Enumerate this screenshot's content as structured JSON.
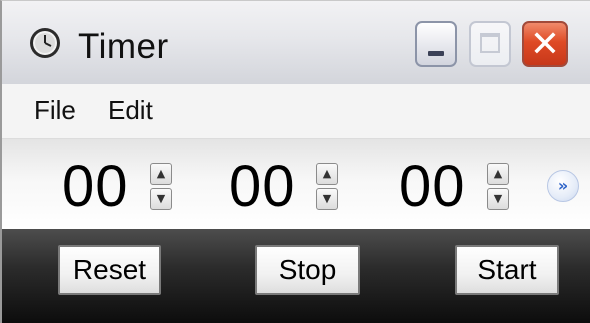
{
  "window": {
    "title": "Timer",
    "controls": {
      "minimize_icon": "minimize-icon",
      "maximize_icon": "maximize-icon",
      "close_glyph": "✕"
    }
  },
  "menu": {
    "items": [
      {
        "label": "File"
      },
      {
        "label": "Edit"
      }
    ]
  },
  "timer": {
    "hours": "00",
    "minutes": "00",
    "seconds": "00",
    "spin_up_glyph": "▲",
    "spin_down_glyph": "▼",
    "expand_glyph": "»"
  },
  "buttons": {
    "reset": "Reset",
    "stop": "Stop",
    "start": "Start"
  },
  "colors": {
    "accent": "#2d63c8",
    "close": "#df4a25"
  }
}
